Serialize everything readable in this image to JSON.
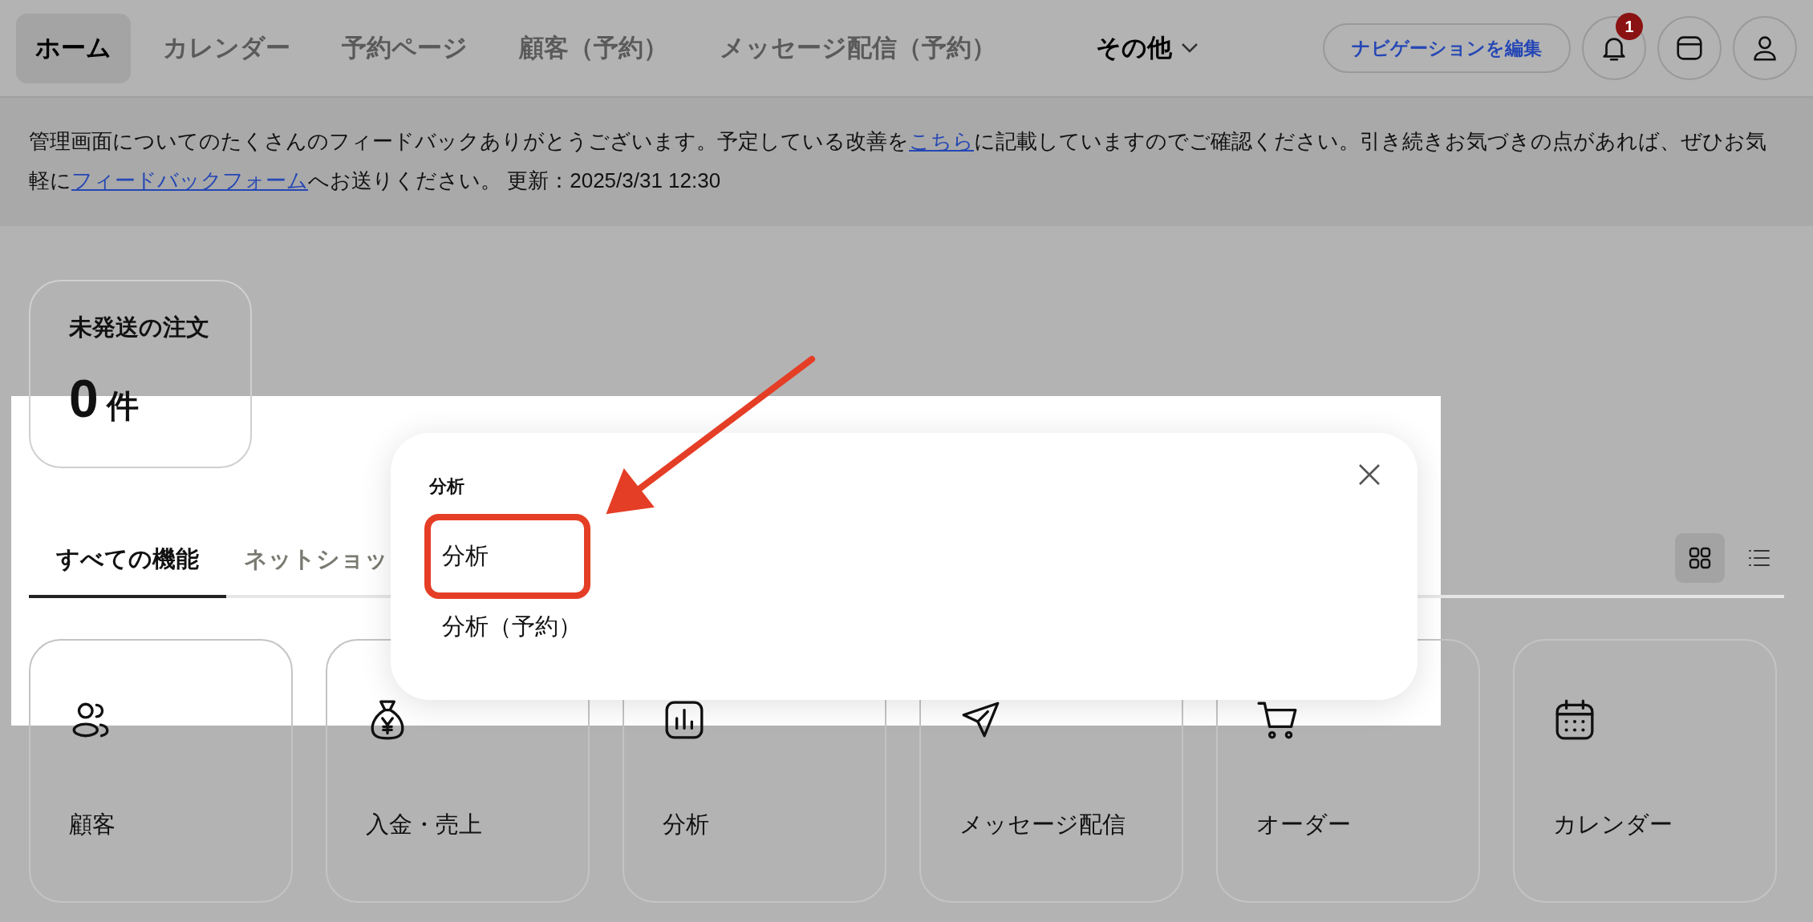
{
  "nav": {
    "tabs": [
      {
        "label": "ホーム",
        "selected": true,
        "kind": "link"
      },
      {
        "label": "カレンダー",
        "selected": false,
        "kind": "link"
      },
      {
        "label": "予約ページ",
        "selected": false,
        "kind": "link"
      },
      {
        "label": "顧客（予約）",
        "selected": false,
        "kind": "link"
      },
      {
        "label": "メッセージ配信（予約）",
        "selected": false,
        "kind": "link"
      },
      {
        "label": "その他",
        "selected": false,
        "kind": "dropdown"
      }
    ],
    "edit_button": "ナビゲーションを編集",
    "notification_count": "1"
  },
  "notice": {
    "segments": [
      {
        "kind": "text",
        "text": "管理画面についてのたくさんのフィードバックありがとうございます。予定している改善を"
      },
      {
        "kind": "link",
        "text": "こちら"
      },
      {
        "kind": "text",
        "text": "に記載していますのでご確認ください。引き続きお気づきの点があれば、ぜひお気軽に"
      },
      {
        "kind": "link",
        "text": "フィードバックフォーム"
      },
      {
        "kind": "text",
        "text": "へお送りください。 更新：2025/3/31 12:30"
      }
    ]
  },
  "kpi": {
    "title": "未発送の注文",
    "value": "0",
    "unit": "件"
  },
  "feature_tabs": [
    {
      "label": "すべての機能",
      "selected": true
    },
    {
      "label": "ネットショッ",
      "selected": false
    }
  ],
  "view_toggle": [
    {
      "kind": "grid",
      "selected": true
    },
    {
      "kind": "list",
      "selected": false
    }
  ],
  "feature_cards": [
    {
      "kind": "users",
      "label": "顧客"
    },
    {
      "kind": "money",
      "label": "入金・売上"
    },
    {
      "kind": "chart",
      "label": "分析"
    },
    {
      "kind": "send",
      "label": "メッセージ配信"
    },
    {
      "kind": "cart",
      "label": "オーダー"
    },
    {
      "kind": "calendar",
      "label": "カレンダー"
    }
  ],
  "popup": {
    "title": "分析",
    "items": [
      {
        "label": "分析",
        "highlighted": true
      },
      {
        "label": "分析（予約）",
        "highlighted": false
      }
    ]
  }
}
